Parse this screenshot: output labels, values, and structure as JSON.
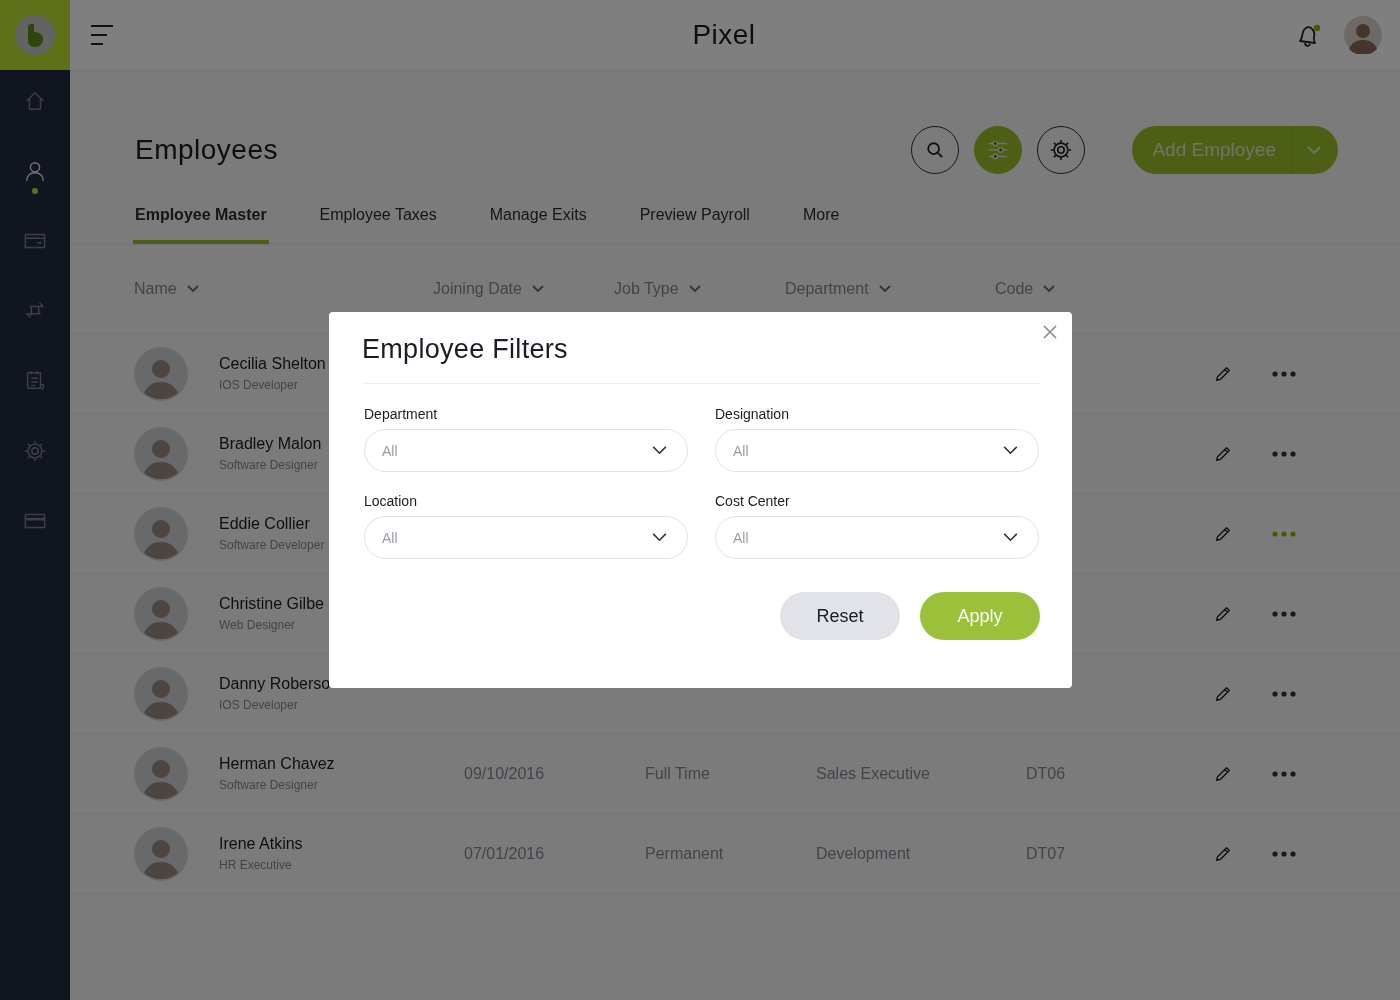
{
  "app": {
    "title": "Pixel",
    "notifications": true
  },
  "sidebar": {
    "items": [
      {
        "kind": "home",
        "selected": false
      },
      {
        "kind": "person",
        "selected": true
      },
      {
        "kind": "card",
        "selected": false
      },
      {
        "kind": "transfer",
        "selected": false
      },
      {
        "kind": "report",
        "selected": false
      },
      {
        "kind": "settings",
        "selected": false
      },
      {
        "kind": "wallet",
        "selected": false
      }
    ]
  },
  "page": {
    "title": "Employees",
    "tools": [
      {
        "kind": "search",
        "selected": false
      },
      {
        "kind": "filter",
        "selected": true
      },
      {
        "kind": "settings",
        "selected": false
      }
    ],
    "primary_button": "Add Employee"
  },
  "tabs": [
    {
      "label": "Employee Master",
      "selected": true
    },
    {
      "label": "Employee Taxes",
      "selected": false
    },
    {
      "label": "Manage Exits",
      "selected": false
    },
    {
      "label": "Preview Payroll",
      "selected": false
    },
    {
      "label": "More",
      "selected": false
    }
  ],
  "table": {
    "columns": [
      {
        "label": "Name"
      },
      {
        "label": "Joining Date"
      },
      {
        "label": "Job Type"
      },
      {
        "label": "Department"
      },
      {
        "label": "Code"
      }
    ],
    "rows": [
      {
        "name": "Cecilia Shelton",
        "designation": "IOS Developer",
        "menu_active": false
      },
      {
        "name": "Bradley Malon",
        "designation": "Software Designer",
        "menu_active": false
      },
      {
        "name": "Eddie Collier",
        "designation": "Software Developer",
        "menu_active": true
      },
      {
        "name": "Christine Gilbe",
        "designation": "Web Designer",
        "menu_active": false
      },
      {
        "name": "Danny Roberso",
        "designation": "IOS Developer",
        "menu_active": false
      },
      {
        "name": "Herman Chavez",
        "designation": "Software Designer",
        "joining_date": "09/10/2016",
        "job_type": "Full Time",
        "department": "Sales Executive",
        "code": "DT06",
        "menu_active": false
      },
      {
        "name": "Irene Atkins",
        "designation": "HR Executive",
        "joining_date": "07/01/2016",
        "job_type": "Permanent",
        "department": "Development",
        "code": "DT07",
        "menu_active": false
      }
    ]
  },
  "modal": {
    "title": "Employee Filters",
    "fields": [
      {
        "label": "Department",
        "value": "All"
      },
      {
        "label": "Designation",
        "value": "All"
      },
      {
        "label": "Location",
        "value": "All"
      },
      {
        "label": "Cost Center",
        "value": "All"
      }
    ],
    "buttons": [
      {
        "label": "Reset",
        "kind": "secondary"
      },
      {
        "label": "Apply",
        "kind": "primary"
      }
    ]
  }
}
